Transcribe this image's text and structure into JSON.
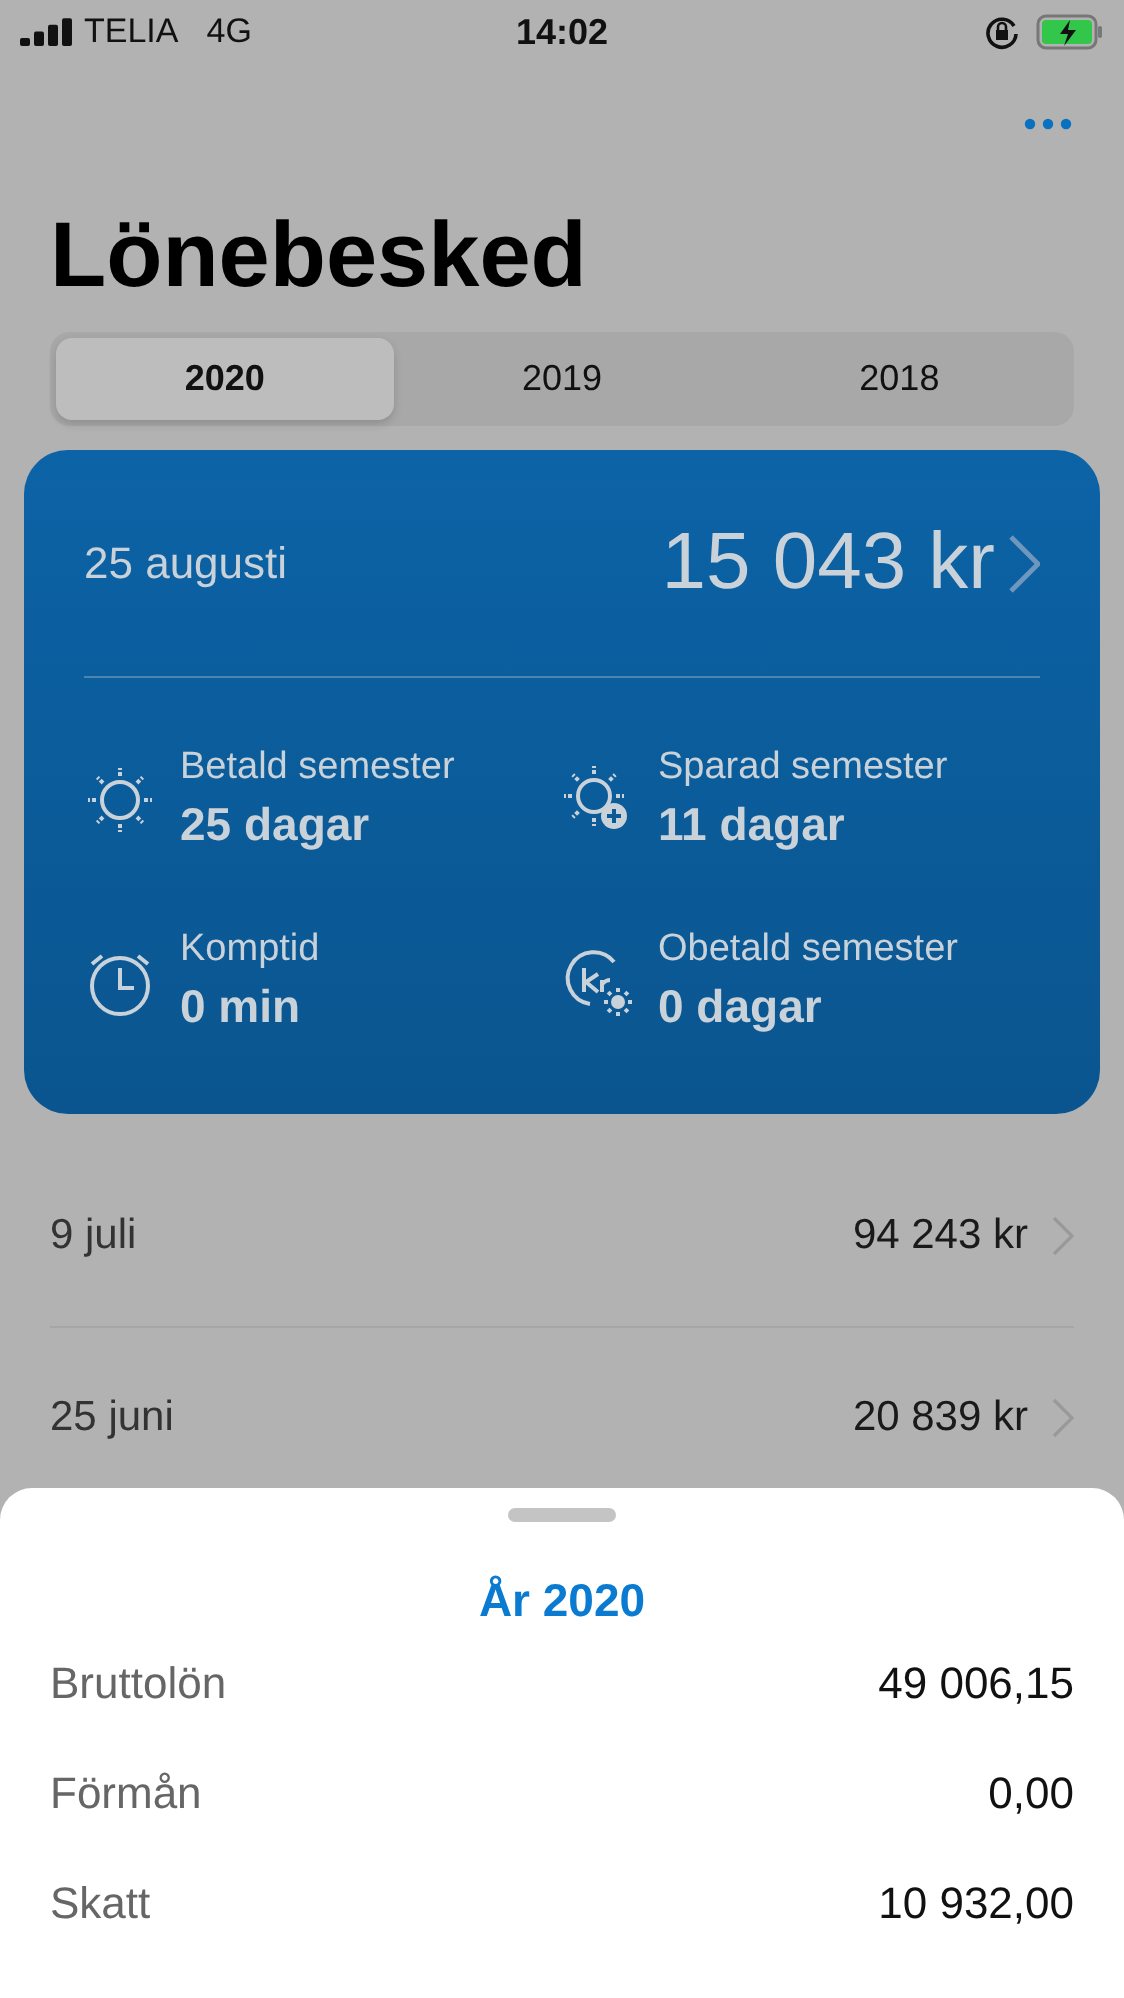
{
  "status_bar": {
    "carrier": "TELIA",
    "network": "4G",
    "time": "14:02"
  },
  "title": "Lönebesked",
  "tabs": [
    {
      "label": "2020",
      "selected": true
    },
    {
      "label": "2019",
      "selected": false
    },
    {
      "label": "2018",
      "selected": false
    }
  ],
  "card": {
    "date": "25 augusti",
    "amount": "15 043 kr",
    "stats": [
      {
        "kind": "sun",
        "label": "Betald semester",
        "value": "25 dagar"
      },
      {
        "kind": "sun-plus",
        "label": "Sparad semester",
        "value": "11 dagar"
      },
      {
        "kind": "clock",
        "label": "Komptid",
        "value": "0 min"
      },
      {
        "kind": "money-sun",
        "label": "Obetald semester",
        "value": "0 dagar"
      }
    ]
  },
  "payslips": [
    {
      "date": "9 juli",
      "amount": "94 243 kr"
    },
    {
      "date": "25 juni",
      "amount": "20 839 kr"
    }
  ],
  "sheet": {
    "title": "År 2020",
    "rows": [
      {
        "label": "Bruttolön",
        "value": "49 006,15"
      },
      {
        "label": "Förmån",
        "value": "0,00"
      },
      {
        "label": "Skatt",
        "value": "10 932,00"
      }
    ]
  }
}
